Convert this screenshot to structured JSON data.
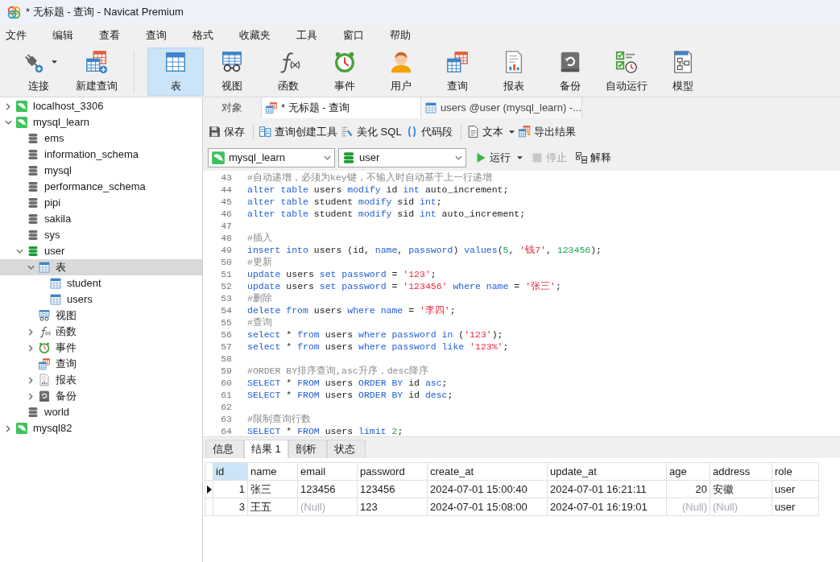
{
  "window": {
    "title": "* 无标题 - 查询 - Navicat Premium"
  },
  "menu": [
    "文件",
    "编辑",
    "查看",
    "查询",
    "格式",
    "收藏夹",
    "工具",
    "窗口",
    "帮助"
  ],
  "toolbar_primary": [
    {
      "label": "连接",
      "kind": "connect",
      "selected": false,
      "dropdown": true
    },
    {
      "label": "新建查询",
      "kind": "new-query",
      "selected": false,
      "dropdown": false
    }
  ],
  "toolbar_objects": [
    {
      "label": "表",
      "kind": "table",
      "selected": true
    },
    {
      "label": "视图",
      "kind": "view",
      "selected": false
    },
    {
      "label": "函数",
      "kind": "function",
      "selected": false
    },
    {
      "label": "事件",
      "kind": "event",
      "selected": false
    },
    {
      "label": "用户",
      "kind": "user",
      "selected": false
    },
    {
      "label": "查询",
      "kind": "query",
      "selected": false
    },
    {
      "label": "报表",
      "kind": "report",
      "selected": false
    },
    {
      "label": "备份",
      "kind": "backup",
      "selected": false
    },
    {
      "label": "自动运行",
      "kind": "automation",
      "selected": false
    },
    {
      "label": "模型",
      "kind": "model",
      "selected": false
    }
  ],
  "tree": [
    {
      "kind": "connection",
      "label": "localhost_3306",
      "expanded": false,
      "selected": false
    },
    {
      "kind": "connection",
      "label": "mysql_learn",
      "expanded": true,
      "selected": false,
      "children": [
        {
          "kind": "database",
          "label": "ems",
          "open": false,
          "selected": false
        },
        {
          "kind": "database",
          "label": "information_schema",
          "open": false,
          "selected": false
        },
        {
          "kind": "database",
          "label": "mysql",
          "open": false,
          "selected": false
        },
        {
          "kind": "database",
          "label": "performance_schema",
          "open": false,
          "selected": false
        },
        {
          "kind": "database",
          "label": "pipi",
          "open": false,
          "selected": false
        },
        {
          "kind": "database",
          "label": "sakila",
          "open": false,
          "selected": false
        },
        {
          "kind": "database",
          "label": "sys",
          "open": false,
          "selected": false
        },
        {
          "kind": "database",
          "label": "user",
          "open": true,
          "expanded": true,
          "selected": false,
          "children": [
            {
              "kind": "tables",
              "label": "表",
              "expanded": true,
              "selected": true,
              "children": [
                {
                  "kind": "table",
                  "label": "student",
                  "selected": false
                },
                {
                  "kind": "table",
                  "label": "users",
                  "selected": false
                }
              ]
            },
            {
              "kind": "views",
              "label": "视图",
              "selected": false
            },
            {
              "kind": "functions",
              "label": "函数",
              "expanded": false,
              "selected": false
            },
            {
              "kind": "events",
              "label": "事件",
              "expanded": false,
              "selected": false
            },
            {
              "kind": "queries",
              "label": "查询",
              "selected": false
            },
            {
              "kind": "reports",
              "label": "报表",
              "expanded": false,
              "selected": false
            },
            {
              "kind": "backups",
              "label": "备份",
              "expanded": false,
              "selected": false
            }
          ]
        },
        {
          "kind": "database",
          "label": "world",
          "open": false,
          "selected": false
        }
      ]
    },
    {
      "kind": "connection",
      "label": "mysql82",
      "expanded": false,
      "selected": false
    }
  ],
  "editor_tabs": [
    {
      "label": "对象",
      "kind": "objects",
      "selected": false
    },
    {
      "label": "* 无标题 - 查询",
      "kind": "query",
      "selected": true
    },
    {
      "label": "users @user (mysql_learn) -...",
      "kind": "table",
      "selected": false
    }
  ],
  "query_toolbar": [
    [
      {
        "label": "保存",
        "kind": "save",
        "dropdown": false
      }
    ],
    [
      {
        "label": "查询创建工具",
        "kind": "builder",
        "dropdown": false
      },
      {
        "label": "美化 SQL",
        "kind": "beautify",
        "dropdown": false
      },
      {
        "label": "代码段",
        "kind": "snippet",
        "dropdown": false
      }
    ],
    [
      {
        "label": "文本",
        "kind": "text",
        "dropdown": true
      },
      {
        "label": "导出结果",
        "kind": "export",
        "dropdown": false
      }
    ]
  ],
  "run_bar": {
    "connection": {
      "value": "mysql_learn"
    },
    "database": {
      "value": "user"
    },
    "buttons": [
      {
        "label": "运行",
        "kind": "run",
        "dropdown": true,
        "disabled": false
      },
      {
        "label": "停止",
        "kind": "stop",
        "dropdown": false,
        "disabled": true
      },
      {
        "label": "解释",
        "kind": "explain",
        "dropdown": false,
        "disabled": false
      }
    ]
  },
  "editor_lines": [
    {
      "number": "43",
      "tokens": [
        {
          "kind": "comment",
          "text": "#自动递增，必须为key键，不输入时自动基于上一行递增"
        }
      ]
    },
    {
      "number": "44",
      "tokens": [
        {
          "kind": "keyword",
          "text": "alter table"
        },
        {
          "kind": "plain",
          "text": " users "
        },
        {
          "kind": "keyword",
          "text": "modify"
        },
        {
          "kind": "plain",
          "text": " id "
        },
        {
          "kind": "keyword",
          "text": "int"
        },
        {
          "kind": "plain",
          "text": " auto_increment;"
        }
      ]
    },
    {
      "number": "45",
      "tokens": [
        {
          "kind": "keyword",
          "text": "alter table"
        },
        {
          "kind": "plain",
          "text": " student "
        },
        {
          "kind": "keyword",
          "text": "modify"
        },
        {
          "kind": "plain",
          "text": " sid "
        },
        {
          "kind": "keyword",
          "text": "int"
        },
        {
          "kind": "plain",
          "text": ";"
        }
      ]
    },
    {
      "number": "46",
      "tokens": [
        {
          "kind": "keyword",
          "text": "alter table"
        },
        {
          "kind": "plain",
          "text": " student "
        },
        {
          "kind": "keyword",
          "text": "modify"
        },
        {
          "kind": "plain",
          "text": " sid "
        },
        {
          "kind": "keyword",
          "text": "int"
        },
        {
          "kind": "plain",
          "text": " auto_increment;"
        }
      ]
    },
    {
      "number": "47"
    },
    {
      "number": "48",
      "tokens": [
        {
          "kind": "comment",
          "text": "#插入"
        }
      ]
    },
    {
      "number": "49",
      "tokens": [
        {
          "kind": "keyword",
          "text": "insert into"
        },
        {
          "kind": "plain",
          "text": " users (id, "
        },
        {
          "kind": "keyword",
          "text": "name"
        },
        {
          "kind": "plain",
          "text": ", "
        },
        {
          "kind": "keyword",
          "text": "password"
        },
        {
          "kind": "plain",
          "text": ") "
        },
        {
          "kind": "keyword",
          "text": "values"
        },
        {
          "kind": "plain",
          "text": "("
        },
        {
          "kind": "number",
          "text": "5"
        },
        {
          "kind": "plain",
          "text": ", "
        },
        {
          "kind": "string",
          "text": "'钱7'"
        },
        {
          "kind": "plain",
          "text": ", "
        },
        {
          "kind": "number",
          "text": "123456"
        },
        {
          "kind": "plain",
          "text": ");"
        }
      ]
    },
    {
      "number": "50",
      "tokens": [
        {
          "kind": "comment",
          "text": "#更新"
        }
      ]
    },
    {
      "number": "51",
      "tokens": [
        {
          "kind": "keyword",
          "text": "update"
        },
        {
          "kind": "plain",
          "text": " users "
        },
        {
          "kind": "keyword",
          "text": "set password"
        },
        {
          "kind": "plain",
          "text": " = "
        },
        {
          "kind": "string",
          "text": "'123'"
        },
        {
          "kind": "plain",
          "text": ";"
        }
      ]
    },
    {
      "number": "52",
      "tokens": [
        {
          "kind": "keyword",
          "text": "update"
        },
        {
          "kind": "plain",
          "text": " users "
        },
        {
          "kind": "keyword",
          "text": "set password"
        },
        {
          "kind": "plain",
          "text": " = "
        },
        {
          "kind": "string",
          "text": "'123456'"
        },
        {
          "kind": "keyword",
          "text": " where name"
        },
        {
          "kind": "plain",
          "text": " = "
        },
        {
          "kind": "string",
          "text": "'张三'"
        },
        {
          "kind": "plain",
          "text": ";"
        }
      ]
    },
    {
      "number": "53",
      "tokens": [
        {
          "kind": "comment",
          "text": "#删除"
        }
      ]
    },
    {
      "number": "54",
      "tokens": [
        {
          "kind": "keyword",
          "text": "delete from"
        },
        {
          "kind": "plain",
          "text": " users "
        },
        {
          "kind": "keyword",
          "text": "where name"
        },
        {
          "kind": "plain",
          "text": " = "
        },
        {
          "kind": "string",
          "text": "'李四'"
        },
        {
          "kind": "plain",
          "text": ";"
        }
      ]
    },
    {
      "number": "55",
      "tokens": [
        {
          "kind": "comment",
          "text": "#查询"
        }
      ]
    },
    {
      "number": "56",
      "tokens": [
        {
          "kind": "keyword",
          "text": "select"
        },
        {
          "kind": "plain",
          "text": " * "
        },
        {
          "kind": "keyword",
          "text": "from"
        },
        {
          "kind": "plain",
          "text": " users "
        },
        {
          "kind": "keyword",
          "text": "where password in"
        },
        {
          "kind": "plain",
          "text": " ("
        },
        {
          "kind": "string",
          "text": "'123'"
        },
        {
          "kind": "plain",
          "text": ");"
        }
      ]
    },
    {
      "number": "57",
      "tokens": [
        {
          "kind": "keyword",
          "text": "select"
        },
        {
          "kind": "plain",
          "text": " * "
        },
        {
          "kind": "keyword",
          "text": "from"
        },
        {
          "kind": "plain",
          "text": " users "
        },
        {
          "kind": "keyword",
          "text": "where password like "
        },
        {
          "kind": "string",
          "text": "'123%'"
        },
        {
          "kind": "plain",
          "text": ";"
        }
      ]
    },
    {
      "number": "58"
    },
    {
      "number": "59",
      "tokens": [
        {
          "kind": "comment",
          "text": "#ORDER BY排序查询,asc升序，desc降序"
        }
      ]
    },
    {
      "number": "60",
      "tokens": [
        {
          "kind": "keyword",
          "text": "SELECT"
        },
        {
          "kind": "plain",
          "text": " * "
        },
        {
          "kind": "keyword",
          "text": "FROM"
        },
        {
          "kind": "plain",
          "text": " users "
        },
        {
          "kind": "keyword",
          "text": "ORDER BY"
        },
        {
          "kind": "plain",
          "text": " id "
        },
        {
          "kind": "keyword",
          "text": "asc"
        },
        {
          "kind": "plain",
          "text": ";"
        }
      ]
    },
    {
      "number": "61",
      "tokens": [
        {
          "kind": "keyword",
          "text": "SELECT"
        },
        {
          "kind": "plain",
          "text": " * "
        },
        {
          "kind": "keyword",
          "text": "FROM"
        },
        {
          "kind": "plain",
          "text": " users "
        },
        {
          "kind": "keyword",
          "text": "ORDER BY"
        },
        {
          "kind": "plain",
          "text": " id "
        },
        {
          "kind": "keyword",
          "text": "desc"
        },
        {
          "kind": "plain",
          "text": ";"
        }
      ]
    },
    {
      "number": "62"
    },
    {
      "number": "63",
      "tokens": [
        {
          "kind": "comment",
          "text": "#限制查询行数"
        }
      ]
    },
    {
      "number": "64",
      "tokens": [
        {
          "kind": "keyword",
          "text": "SELECT"
        },
        {
          "kind": "plain",
          "text": " * "
        },
        {
          "kind": "keyword",
          "text": "FROM"
        },
        {
          "kind": "plain",
          "text": " users "
        },
        {
          "kind": "keyword",
          "text": "limit "
        },
        {
          "kind": "number",
          "text": "2"
        },
        {
          "kind": "plain",
          "text": ";"
        }
      ]
    }
  ],
  "result_tabs": [
    {
      "label": "信息",
      "selected": false
    },
    {
      "label": "结果 1",
      "selected": true
    },
    {
      "label": "剖析",
      "selected": false
    },
    {
      "label": "状态",
      "selected": false
    }
  ],
  "result_grid": {
    "columns": [
      {
        "label": "id",
        "numeric": true,
        "selected": true
      },
      {
        "label": "name",
        "numeric": false,
        "selected": false
      },
      {
        "label": "email",
        "numeric": false,
        "selected": false
      },
      {
        "label": "password",
        "numeric": false,
        "selected": false
      },
      {
        "label": "create_at",
        "numeric": false,
        "selected": false
      },
      {
        "label": "update_at",
        "numeric": false,
        "selected": false
      },
      {
        "label": "age",
        "numeric": true,
        "selected": false
      },
      {
        "label": "address",
        "numeric": false,
        "selected": false
      },
      {
        "label": "role",
        "numeric": false,
        "selected": false
      }
    ],
    "rows": [
      {
        "current": true,
        "cells": [
          {
            "text": "1",
            "null": false
          },
          {
            "text": "张三",
            "null": false
          },
          {
            "text": "123456",
            "null": false
          },
          {
            "text": "123456",
            "null": false
          },
          {
            "text": "2024-07-01 15:00:40",
            "null": false
          },
          {
            "text": "2024-07-01 16:21:11",
            "null": false
          },
          {
            "text": "20",
            "null": false
          },
          {
            "text": "安徽",
            "null": false
          },
          {
            "text": "user",
            "null": false
          }
        ]
      },
      {
        "current": false,
        "cells": [
          {
            "text": "3",
            "null": false
          },
          {
            "text": "王五",
            "null": false
          },
          {
            "text": "(Null)",
            "null": true
          },
          {
            "text": "123",
            "null": false
          },
          {
            "text": "2024-07-01 15:08:00",
            "null": false
          },
          {
            "text": "2024-07-01 16:19:01",
            "null": false
          },
          {
            "text": "(Null)",
            "null": true
          },
          {
            "text": "(Null)",
            "null": true
          },
          {
            "text": "user",
            "null": false
          }
        ]
      }
    ]
  }
}
